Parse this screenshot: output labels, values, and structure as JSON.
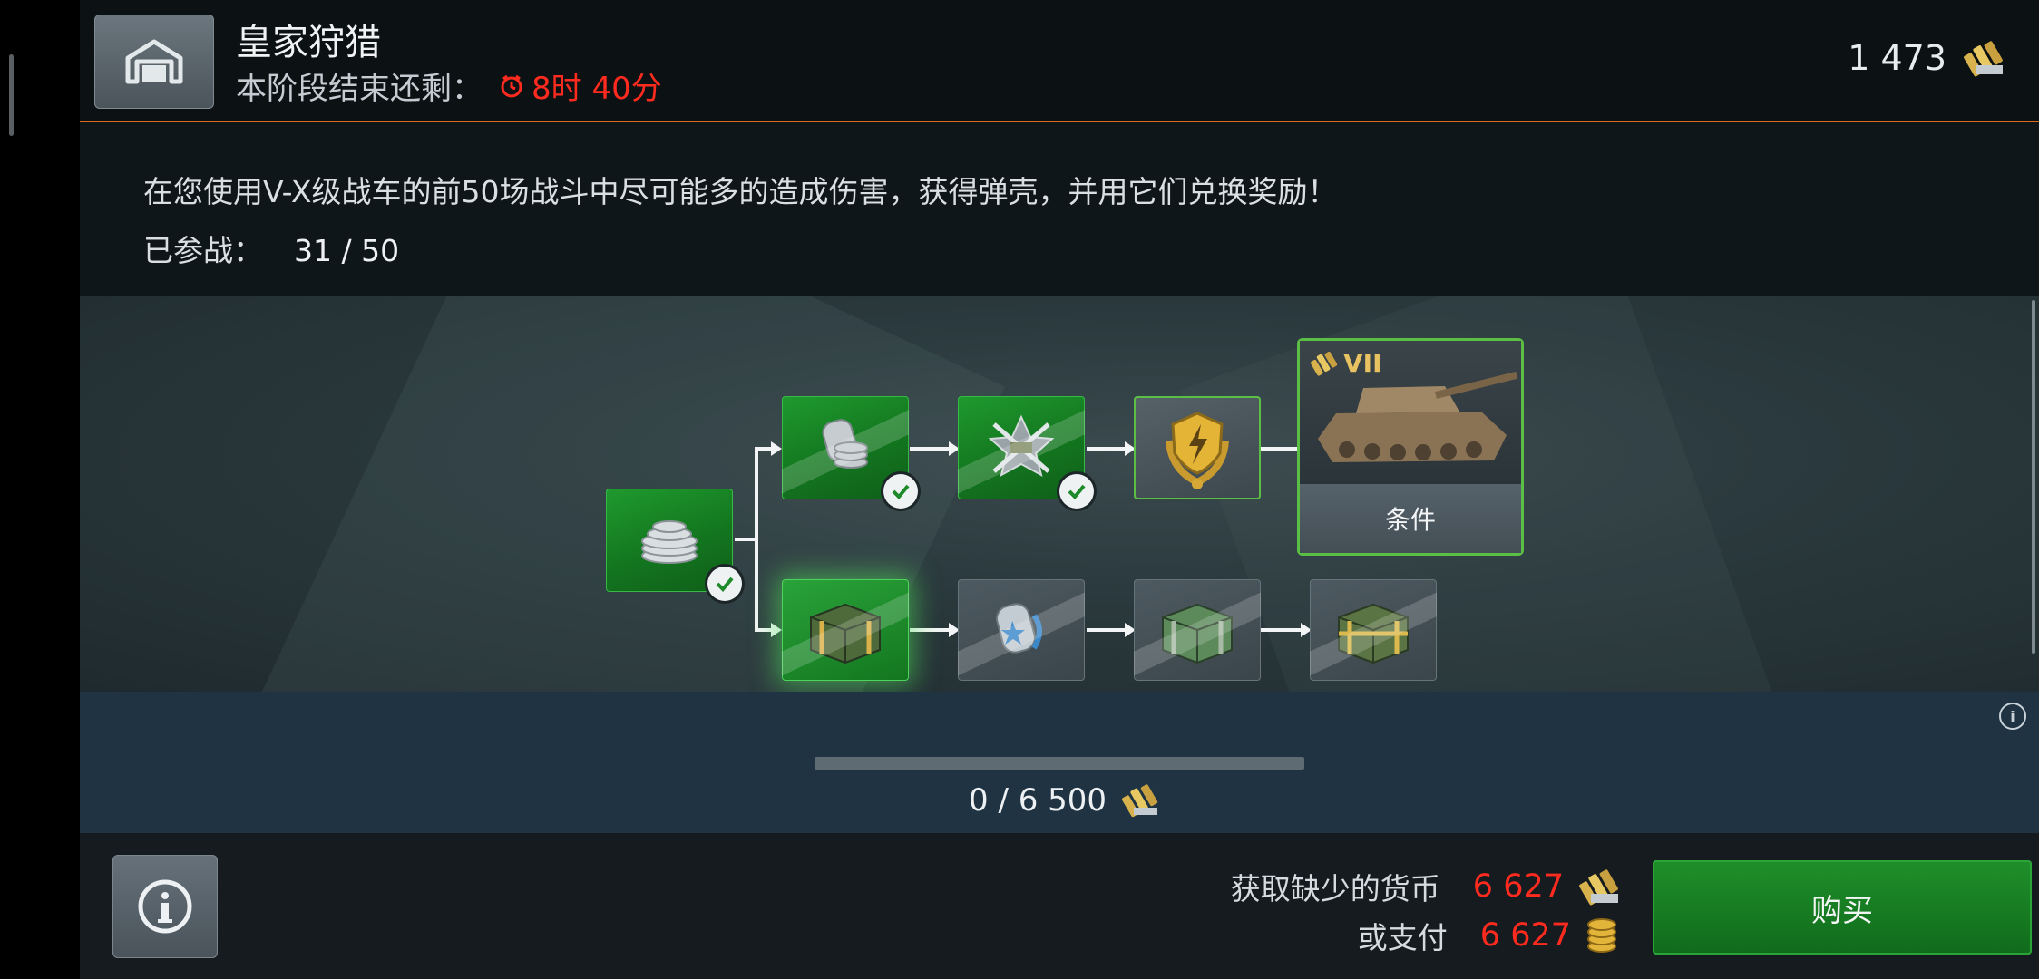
{
  "header": {
    "title": "皇家狩猎",
    "timer_label": "本阶段结束还剩：",
    "timer_value": "8时 40分",
    "currency_amount": "1 473"
  },
  "description": {
    "text": "在您使用V-X级战车的前50场战斗中尽可能多的造成伤害，获得弹壳，并用它们兑换奖励！",
    "battles_label": "已参战：",
    "battles_value": "31 / 50"
  },
  "reward_tree": {
    "tank_card": {
      "tier": "VII",
      "button_label": "条件"
    }
  },
  "progress": {
    "value_text": "0 / 6 500",
    "fraction": 0
  },
  "footer": {
    "missing_label": "获取缺少的货币",
    "missing_value": "6 627",
    "or_pay_label": "或支付",
    "or_pay_value": "6 627",
    "buy_label": "购买"
  },
  "colors": {
    "accent_orange": "#e06a1c",
    "green": "#1a8a28",
    "red_text": "#ff2b1f"
  }
}
